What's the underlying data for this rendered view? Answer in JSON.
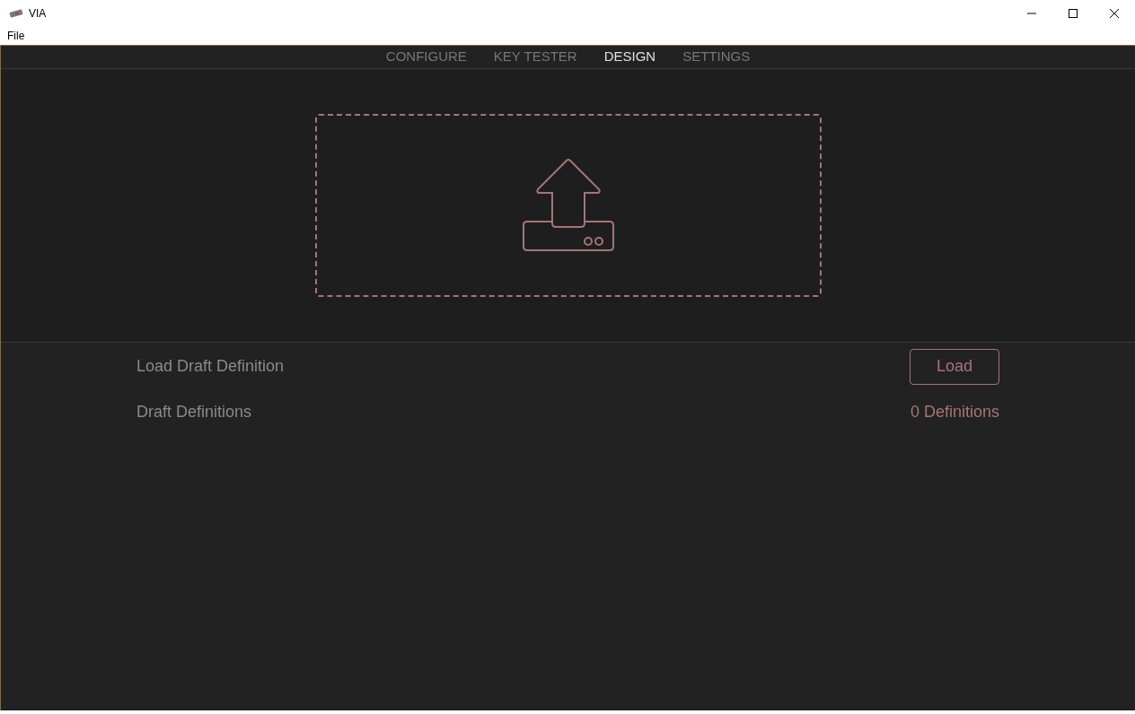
{
  "window": {
    "title": "VIA"
  },
  "menu": [
    "File"
  ],
  "tabs": [
    {
      "label": "CONFIGURE",
      "selected": false
    },
    {
      "label": "KEY TESTER",
      "selected": false
    },
    {
      "label": "DESIGN",
      "selected": true
    },
    {
      "label": "SETTINGS",
      "selected": false
    }
  ],
  "rows": [
    {
      "kind": "button",
      "label": "Load Draft Definition",
      "action": "Load"
    },
    {
      "kind": "value",
      "label": "Draft Definitions",
      "value": "0 Definitions"
    }
  ]
}
